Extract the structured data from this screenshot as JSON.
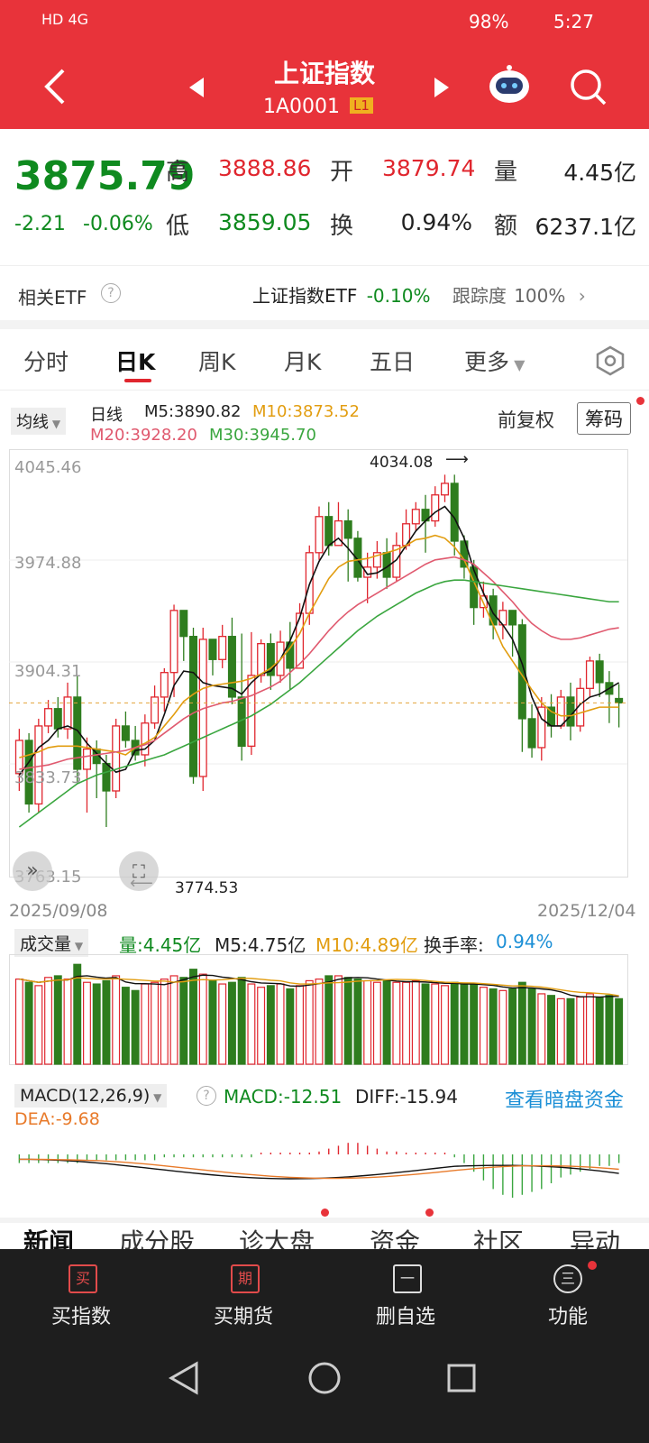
{
  "status_bar": {
    "left": "HD 4G",
    "battery": "98%",
    "time": "5:27"
  },
  "header": {
    "title": "上证指数",
    "code": "1A0001",
    "level": "L1"
  },
  "quote": {
    "price": "3875.79",
    "change": "-2.21",
    "change_pct": "-0.06%",
    "high_label": "高",
    "high": "3888.86",
    "open_label": "开",
    "open": "3879.74",
    "vol_label": "量",
    "vol": "4.45亿",
    "low_label": "低",
    "low": "3859.05",
    "turn_label": "换",
    "turn": "0.94%",
    "amt_label": "额",
    "amt": "6237.1亿"
  },
  "etf": {
    "label": "相关ETF",
    "name": "上证指数ETF",
    "change": "-0.10%",
    "track_label": "跟踪度",
    "track": "100%"
  },
  "tabs": [
    "分时",
    "日K",
    "周K",
    "月K",
    "五日",
    "更多"
  ],
  "chart_header": {
    "ma_dropdown": "均线",
    "period": "日线",
    "m5": "M5:3890.82",
    "m10": "M10:3873.52",
    "m20": "M20:3928.20",
    "m30": "M30:3945.70",
    "adjust": "前复权",
    "chips": "筹码"
  },
  "chart_data": [
    {
      "type": "candlestick",
      "title": "日线",
      "x_start": "2025/09/08",
      "x_end": "2025/12/04",
      "y_ticks": [
        "4045.46",
        "3974.88",
        "3904.31",
        "3833.73",
        "3763.15"
      ],
      "ylim": [
        3763.15,
        4045.46
      ],
      "high_mark": "4034.08",
      "low_mark": "3774.53",
      "candles": [
        [
          3827,
          3850,
          3815,
          3858
        ],
        [
          3850,
          3806,
          3800,
          3855
        ],
        [
          3806,
          3860,
          3800,
          3865
        ],
        [
          3860,
          3872,
          3855,
          3878
        ],
        [
          3872,
          3858,
          3852,
          3880
        ],
        [
          3858,
          3880,
          3851,
          3890
        ],
        [
          3880,
          3830,
          3820,
          3895
        ],
        [
          3830,
          3844,
          3800,
          3852
        ],
        [
          3844,
          3834,
          3810,
          3850
        ],
        [
          3834,
          3815,
          3790,
          3840
        ],
        [
          3815,
          3860,
          3810,
          3865
        ],
        [
          3860,
          3850,
          3845,
          3870
        ],
        [
          3850,
          3840,
          3836,
          3860
        ],
        [
          3840,
          3862,
          3832,
          3868
        ],
        [
          3862,
          3880,
          3858,
          3888
        ],
        [
          3880,
          3897,
          3870,
          3900
        ],
        [
          3897,
          3940,
          3880,
          3944
        ],
        [
          3940,
          3922,
          3905,
          3926
        ],
        [
          3922,
          3825,
          3820,
          3928
        ],
        [
          3825,
          3920,
          3815,
          3928
        ],
        [
          3920,
          3906,
          3895,
          3912
        ],
        [
          3906,
          3922,
          3900,
          3930
        ],
        [
          3922,
          3880,
          3875,
          3935
        ],
        [
          3880,
          3846,
          3836,
          3924
        ],
        [
          3846,
          3895,
          3840,
          3925
        ],
        [
          3895,
          3917,
          3890,
          3920
        ],
        [
          3917,
          3895,
          3885,
          3924
        ],
        [
          3895,
          3918,
          3890,
          3926
        ],
        [
          3918,
          3900,
          3885,
          3932
        ],
        [
          3900,
          3938,
          3900,
          3945
        ],
        [
          3938,
          3980,
          3930,
          3985
        ],
        [
          3980,
          4005,
          3975,
          4012
        ],
        [
          4005,
          3985,
          3978,
          4015
        ],
        [
          3985,
          4002,
          3985,
          4015
        ],
        [
          4002,
          3990,
          3960,
          4010
        ],
        [
          3990,
          3963,
          3960,
          3995
        ],
        [
          3963,
          3970,
          3945,
          3980
        ],
        [
          3970,
          3980,
          3962,
          3988
        ],
        [
          3980,
          3963,
          3955,
          3990
        ],
        [
          3963,
          3985,
          3960,
          3994
        ],
        [
          3985,
          4000,
          3982,
          4010
        ],
        [
          4000,
          4010,
          3995,
          4015
        ],
        [
          4010,
          4002,
          3980,
          4020
        ],
        [
          4002,
          4020,
          3998,
          4026
        ],
        [
          4020,
          4028,
          4015,
          4034
        ],
        [
          4028,
          3988,
          3978,
          4034
        ],
        [
          3988,
          3970,
          3962,
          3992
        ],
        [
          3970,
          3942,
          3930,
          3975
        ],
        [
          3942,
          3950,
          3935,
          3960
        ],
        [
          3950,
          3930,
          3920,
          3955
        ],
        [
          3930,
          3940,
          3920,
          3946
        ],
        [
          3940,
          3930,
          3908,
          3940
        ],
        [
          3930,
          3865,
          3842,
          3934
        ],
        [
          3865,
          3845,
          3838,
          3875
        ],
        [
          3845,
          3873,
          3836,
          3880
        ],
        [
          3873,
          3860,
          3852,
          3882
        ],
        [
          3860,
          3880,
          3858,
          3885
        ],
        [
          3880,
          3860,
          3850,
          3890
        ],
        [
          3860,
          3886,
          3856,
          3893
        ],
        [
          3886,
          3905,
          3880,
          3908
        ],
        [
          3905,
          3890,
          3880,
          3910
        ],
        [
          3890,
          3882,
          3862,
          3898
        ],
        [
          3879,
          3876,
          3859,
          3889
        ]
      ],
      "ma": {
        "M5": [
          3826,
          3835,
          3845,
          3850,
          3858,
          3860,
          3857,
          3848,
          3841,
          3834,
          3828,
          3830,
          3843,
          3844,
          3850,
          3868,
          3888,
          3898,
          3897,
          3890,
          3888,
          3887,
          3886,
          3882,
          3890,
          3896,
          3898,
          3906,
          3919,
          3935,
          3958,
          3974,
          3985,
          3990,
          3983,
          3975,
          3965,
          3966,
          3970,
          3975,
          3985,
          3995,
          4002,
          4008,
          4012,
          4004,
          3990,
          3968,
          3952,
          3938,
          3930,
          3920,
          3903,
          3880,
          3865,
          3860,
          3860,
          3867,
          3875,
          3880,
          3882,
          3886,
          3890
        ],
        "M10": [
          3838,
          3840,
          3842,
          3845,
          3846,
          3846,
          3846,
          3845,
          3844,
          3843,
          3842,
          3840,
          3845,
          3848,
          3852,
          3860,
          3868,
          3877,
          3882,
          3886,
          3888,
          3889,
          3890,
          3891,
          3893,
          3896,
          3900,
          3906,
          3914,
          3924,
          3938,
          3950,
          3962,
          3970,
          3974,
          3975,
          3976,
          3978,
          3980,
          3982,
          3985,
          3989,
          3990,
          3992,
          3990,
          3984,
          3975,
          3960,
          3945,
          3930,
          3915,
          3905,
          3895,
          3885,
          3876,
          3870,
          3867,
          3867,
          3869,
          3871,
          3873,
          3873,
          3873
        ],
        "M20": [
          3830,
          3831,
          3832,
          3833,
          3835,
          3837,
          3838,
          3839,
          3840,
          3841,
          3842,
          3843,
          3845,
          3847,
          3850,
          3855,
          3860,
          3865,
          3869,
          3872,
          3874,
          3876,
          3877,
          3879,
          3881,
          3884,
          3887,
          3891,
          3897,
          3903,
          3910,
          3918,
          3926,
          3933,
          3939,
          3944,
          3948,
          3952,
          3956,
          3960,
          3964,
          3968,
          3972,
          3975,
          3976,
          3977,
          3975,
          3972,
          3966,
          3960,
          3953,
          3946,
          3938,
          3931,
          3926,
          3922,
          3920,
          3920,
          3921,
          3923,
          3925,
          3927,
          3928
        ],
        "M30": [
          3790,
          3795,
          3800,
          3805,
          3810,
          3815,
          3820,
          3823,
          3826,
          3828,
          3830,
          3832,
          3834,
          3836,
          3838,
          3840,
          3843,
          3846,
          3849,
          3852,
          3855,
          3858,
          3861,
          3864,
          3867,
          3871,
          3875,
          3880,
          3885,
          3890,
          3896,
          3902,
          3908,
          3914,
          3920,
          3926,
          3931,
          3936,
          3940,
          3944,
          3948,
          3952,
          3955,
          3958,
          3960,
          3961,
          3961,
          3960,
          3959,
          3958,
          3957,
          3956,
          3955,
          3954,
          3953,
          3952,
          3951,
          3950,
          3949,
          3948,
          3947,
          3946,
          3946
        ]
      }
    },
    {
      "type": "bar",
      "title": "成交量",
      "volumes": [
        5.2,
        5.0,
        4.8,
        5.3,
        5.4,
        5.2,
        6.1,
        5.0,
        4.9,
        5.1,
        5.4,
        4.7,
        4.5,
        4.9,
        5.0,
        5.2,
        5.4,
        5.3,
        5.8,
        5.5,
        5.1,
        4.9,
        5.0,
        5.3,
        4.9,
        4.7,
        4.8,
        4.9,
        4.6,
        4.8,
        5.1,
        5.2,
        5.4,
        5.4,
        5.3,
        5.2,
        5.1,
        5.0,
        5.1,
        5.0,
        5.0,
        5.1,
        4.9,
        4.9,
        4.8,
        5.0,
        4.9,
        4.9,
        4.7,
        4.6,
        4.5,
        4.6,
        5.0,
        4.6,
        4.3,
        4.2,
        4.0,
        4.0,
        4.1,
        4.3,
        4.1,
        4.2,
        4.0
      ],
      "ylim": [
        0,
        6.5
      ]
    },
    {
      "type": "bar",
      "title": "MACD(12,26,9)",
      "macd": [
        -3,
        -3,
        -3,
        -3,
        -3,
        -3,
        -3,
        -2,
        -2,
        -2,
        -2,
        -2,
        -2,
        -2,
        -2,
        -1,
        -1,
        -1,
        -1,
        -1,
        -1,
        -1,
        -1,
        -1,
        -1,
        0,
        0,
        0,
        0,
        0,
        0,
        1,
        2,
        3,
        4,
        4,
        3,
        2,
        1,
        1,
        0,
        0,
        0,
        0,
        0,
        -1,
        -3,
        -6,
        -9,
        -12,
        -14,
        -15,
        -14,
        -13,
        -12,
        -10,
        -8,
        -7,
        -6,
        -5,
        -4,
        -4,
        -3
      ]
    }
  ],
  "vol_header": {
    "dropdown": "成交量",
    "vol": "量:4.45亿",
    "m5": "M5:4.75亿",
    "m10": "M10:4.89亿",
    "turnover_label": "换手率:",
    "turnover": "0.94%"
  },
  "macd_header": {
    "dropdown": "MACD(12,26,9)",
    "macd": "MACD:-12.51",
    "diff": "DIFF:-15.94",
    "dea": "DEA:-9.68",
    "link": "查看暗盘资金"
  },
  "news_tabs": [
    "新闻",
    "成分股",
    "诊大盘",
    "资金",
    "社区",
    "异动"
  ],
  "bottom_nav": [
    {
      "icon": "买",
      "label": "买指数"
    },
    {
      "icon": "期",
      "label": "买期货"
    },
    {
      "icon": "一",
      "label": "删自选"
    },
    {
      "icon": "三",
      "label": "功能"
    }
  ]
}
